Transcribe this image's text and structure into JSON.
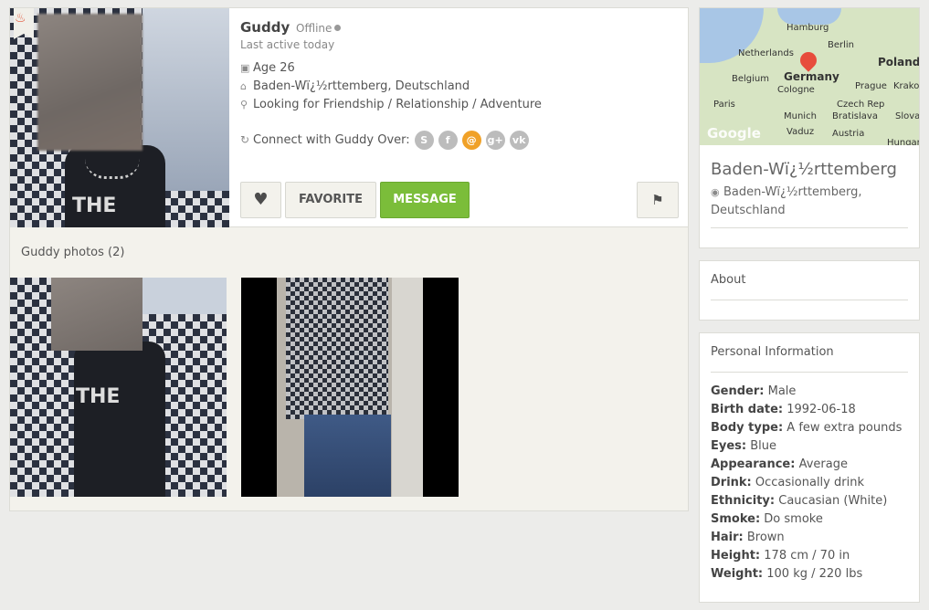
{
  "profile": {
    "name": "Guddy",
    "status": "Offline",
    "last_active": "Last active today",
    "age": "Age 26",
    "location": "Baden-Wï¿½rttemberg, Deutschland",
    "looking_for": "Looking for Friendship / Relationship / Adventure",
    "connect_label": "Connect with Guddy Over:",
    "social": [
      {
        "icon": "skype-icon",
        "glyph": "S"
      },
      {
        "icon": "facebook-icon",
        "glyph": "f"
      },
      {
        "icon": "email-icon",
        "glyph": "@"
      },
      {
        "icon": "google-plus-icon",
        "glyph": "g+"
      },
      {
        "icon": "vk-icon",
        "glyph": "vk"
      }
    ]
  },
  "actions": {
    "favorite_label": "FAVORITE",
    "message_label": "MESSAGE"
  },
  "photos": {
    "title": "Guddy photos (2)",
    "avatar_shirt_text": "THE",
    "photo1_shirt_text": "THE"
  },
  "map": {
    "labels": {
      "hamburg": "Hamburg",
      "berlin": "Berlin",
      "netherlands": "Netherlands",
      "poland": "Poland",
      "belgium": "Belgium",
      "germany": "Germany",
      "cologne": "Cologne",
      "prague": "Prague",
      "krakow": "Krakov",
      "paris": "Paris",
      "czech": "Czech Rep",
      "munich": "Munich",
      "bratislava": "Bratislava",
      "slova": "Slova",
      "vaduz": "Vaduz",
      "austria": "Austria",
      "hungary": "Hungar"
    },
    "watermark": "Google"
  },
  "region": {
    "title": "Baden-Wï¿½rttemberg",
    "location": "Baden-Wï¿½rttemberg, Deutschland"
  },
  "about": {
    "title": "About"
  },
  "personal": {
    "title": "Personal Information",
    "rows": [
      {
        "label": "Gender:",
        "value": "Male"
      },
      {
        "label": "Birth date:",
        "value": "1992-06-18"
      },
      {
        "label": "Body type:",
        "value": "A few extra pounds"
      },
      {
        "label": "Eyes:",
        "value": "Blue"
      },
      {
        "label": "Appearance:",
        "value": "Average"
      },
      {
        "label": "Drink:",
        "value": "Occasionally drink"
      },
      {
        "label": "Ethnicity:",
        "value": "Caucasian (White)"
      },
      {
        "label": "Smoke:",
        "value": "Do smoke"
      },
      {
        "label": "Hair:",
        "value": "Brown"
      },
      {
        "label": "Height:",
        "value": "178 cm / 70 in"
      },
      {
        "label": "Weight:",
        "value": "100 kg / 220 lbs"
      }
    ]
  },
  "colors": {
    "accent_green": "#7bbd3a",
    "email_orange": "#f0a128",
    "flame_red": "#e2553a"
  }
}
